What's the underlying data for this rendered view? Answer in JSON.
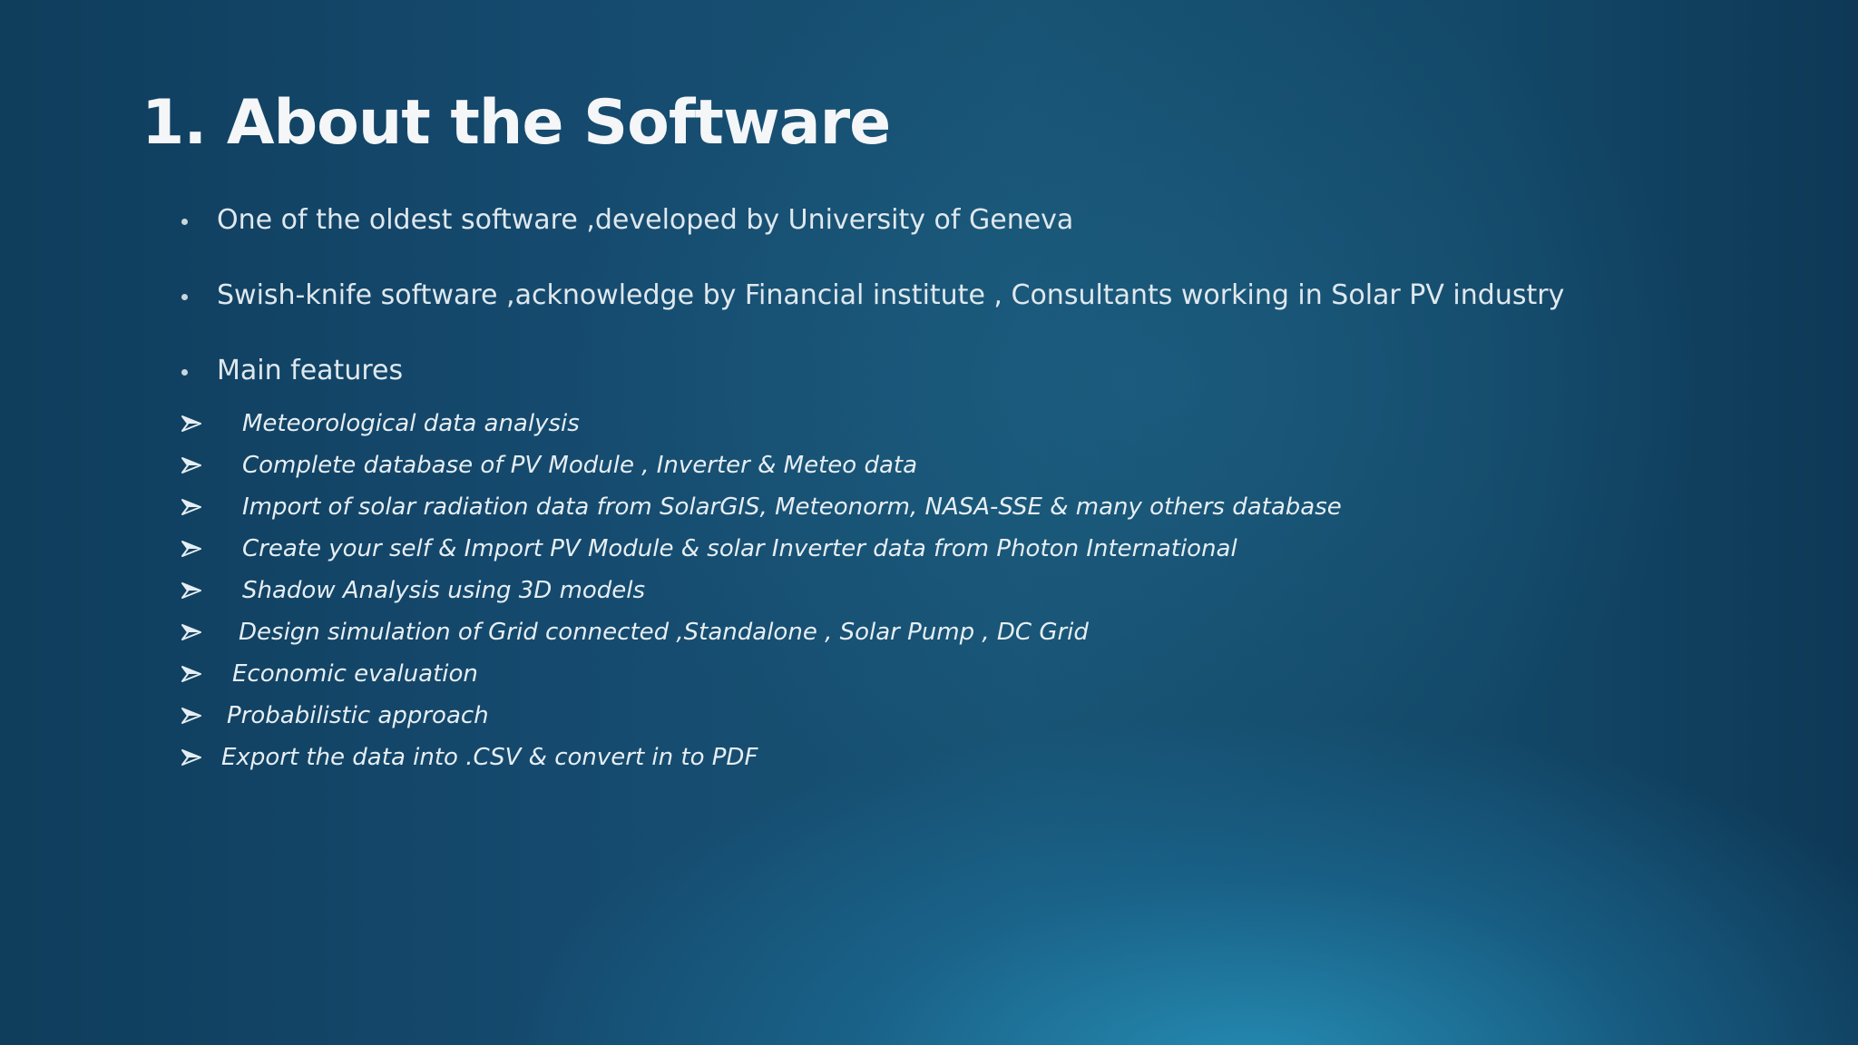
{
  "slide": {
    "title": "1.  About the Software",
    "bullets": [
      "One of the oldest software ,developed by University of Geneva",
      "Swish-knife software   ,acknowledge by Financial institute , Consultants  working in Solar PV industry",
      "Main features"
    ],
    "features": [
      "Meteorological data analysis",
      "Complete database of PV Module , Inverter & Meteo data",
      "Import of solar radiation data from SolarGIS, Meteonorm, NASA-SSE & many others database",
      "Create your self & Import  PV Module & solar Inverter data from Photon International",
      "Shadow Analysis using 3D models",
      "Design simulation of Grid connected ,Standalone , Solar Pump ,  DC  Grid",
      "Economic evaluation",
      "Probabilistic approach",
      "Export  the data  into .CSV & convert in to PDF"
    ],
    "bullet_icon": "round-bullet",
    "feature_icon": "arrowhead-bullet-icon",
    "colors": {
      "background_dark": "#0f3d5c",
      "background_glow": "#2896be",
      "text": "#eef3f6"
    }
  }
}
